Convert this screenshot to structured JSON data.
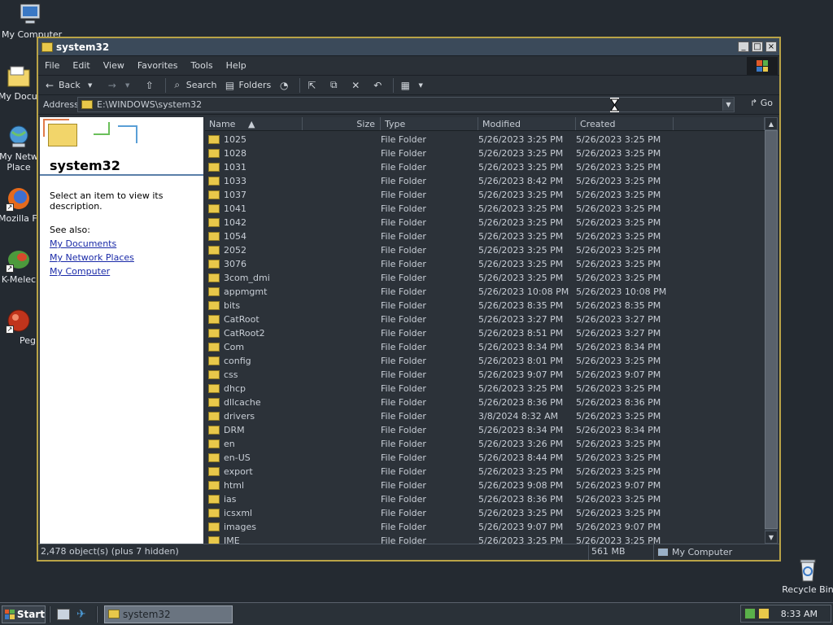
{
  "desktop": {
    "icons": [
      {
        "label": "My Computer"
      },
      {
        "label": "My Documents"
      },
      {
        "label": "My Network Places"
      },
      {
        "label": "Mozilla Firefox"
      },
      {
        "label": "K-Meleon"
      },
      {
        "label": "Pegasus"
      },
      {
        "label": "Recycle Bin"
      }
    ]
  },
  "window": {
    "title": "system32",
    "controls": {
      "minimize": "_",
      "maximize": "□",
      "close": "×"
    },
    "menu": [
      "File",
      "Edit",
      "View",
      "Favorites",
      "Tools",
      "Help"
    ],
    "toolbar": {
      "back": "Back",
      "search": "Search",
      "folders": "Folders"
    },
    "address": {
      "label": "Address",
      "value": "E:\\WINDOWS\\system32",
      "go": "Go"
    },
    "left_pane": {
      "title": "system32",
      "description": "Select an item to view its description.",
      "see_also": "See also:",
      "links": [
        "My Documents",
        "My Network Places",
        "My Computer"
      ]
    },
    "columns": {
      "name": "Name",
      "size": "Size",
      "type": "Type",
      "modified": "Modified",
      "created": "Created"
    },
    "rows": [
      {
        "name": "1025",
        "type": "File Folder",
        "modified": "5/26/2023 3:25 PM",
        "created": "5/26/2023 3:25 PM"
      },
      {
        "name": "1028",
        "type": "File Folder",
        "modified": "5/26/2023 3:25 PM",
        "created": "5/26/2023 3:25 PM"
      },
      {
        "name": "1031",
        "type": "File Folder",
        "modified": "5/26/2023 3:25 PM",
        "created": "5/26/2023 3:25 PM"
      },
      {
        "name": "1033",
        "type": "File Folder",
        "modified": "5/26/2023 8:42 PM",
        "created": "5/26/2023 3:25 PM"
      },
      {
        "name": "1037",
        "type": "File Folder",
        "modified": "5/26/2023 3:25 PM",
        "created": "5/26/2023 3:25 PM"
      },
      {
        "name": "1041",
        "type": "File Folder",
        "modified": "5/26/2023 3:25 PM",
        "created": "5/26/2023 3:25 PM"
      },
      {
        "name": "1042",
        "type": "File Folder",
        "modified": "5/26/2023 3:25 PM",
        "created": "5/26/2023 3:25 PM"
      },
      {
        "name": "1054",
        "type": "File Folder",
        "modified": "5/26/2023 3:25 PM",
        "created": "5/26/2023 3:25 PM"
      },
      {
        "name": "2052",
        "type": "File Folder",
        "modified": "5/26/2023 3:25 PM",
        "created": "5/26/2023 3:25 PM"
      },
      {
        "name": "3076",
        "type": "File Folder",
        "modified": "5/26/2023 3:25 PM",
        "created": "5/26/2023 3:25 PM"
      },
      {
        "name": "3com_dmi",
        "type": "File Folder",
        "modified": "5/26/2023 3:25 PM",
        "created": "5/26/2023 3:25 PM"
      },
      {
        "name": "appmgmt",
        "type": "File Folder",
        "modified": "5/26/2023 10:08 PM",
        "created": "5/26/2023 10:08 PM"
      },
      {
        "name": "bits",
        "type": "File Folder",
        "modified": "5/26/2023 8:35 PM",
        "created": "5/26/2023 8:35 PM"
      },
      {
        "name": "CatRoot",
        "type": "File Folder",
        "modified": "5/26/2023 3:27 PM",
        "created": "5/26/2023 3:27 PM"
      },
      {
        "name": "CatRoot2",
        "type": "File Folder",
        "modified": "5/26/2023 8:51 PM",
        "created": "5/26/2023 3:27 PM"
      },
      {
        "name": "Com",
        "type": "File Folder",
        "modified": "5/26/2023 8:34 PM",
        "created": "5/26/2023 8:34 PM"
      },
      {
        "name": "config",
        "type": "File Folder",
        "modified": "5/26/2023 8:01 PM",
        "created": "5/26/2023 3:25 PM"
      },
      {
        "name": "css",
        "type": "File Folder",
        "modified": "5/26/2023 9:07 PM",
        "created": "5/26/2023 9:07 PM"
      },
      {
        "name": "dhcp",
        "type": "File Folder",
        "modified": "5/26/2023 3:25 PM",
        "created": "5/26/2023 3:25 PM"
      },
      {
        "name": "dllcache",
        "type": "File Folder",
        "modified": "5/26/2023 8:36 PM",
        "created": "5/26/2023 8:36 PM"
      },
      {
        "name": "drivers",
        "type": "File Folder",
        "modified": "3/8/2024 8:32 AM",
        "created": "5/26/2023 3:25 PM"
      },
      {
        "name": "DRM",
        "type": "File Folder",
        "modified": "5/26/2023 8:34 PM",
        "created": "5/26/2023 8:34 PM"
      },
      {
        "name": "en",
        "type": "File Folder",
        "modified": "5/26/2023 3:26 PM",
        "created": "5/26/2023 3:25 PM"
      },
      {
        "name": "en-US",
        "type": "File Folder",
        "modified": "5/26/2023 8:44 PM",
        "created": "5/26/2023 3:25 PM"
      },
      {
        "name": "export",
        "type": "File Folder",
        "modified": "5/26/2023 3:25 PM",
        "created": "5/26/2023 3:25 PM"
      },
      {
        "name": "html",
        "type": "File Folder",
        "modified": "5/26/2023 9:08 PM",
        "created": "5/26/2023 9:07 PM"
      },
      {
        "name": "ias",
        "type": "File Folder",
        "modified": "5/26/2023 8:36 PM",
        "created": "5/26/2023 3:25 PM"
      },
      {
        "name": "icsxml",
        "type": "File Folder",
        "modified": "5/26/2023 3:25 PM",
        "created": "5/26/2023 3:25 PM"
      },
      {
        "name": "images",
        "type": "File Folder",
        "modified": "5/26/2023 9:07 PM",
        "created": "5/26/2023 9:07 PM"
      },
      {
        "name": "IME",
        "type": "File Folder",
        "modified": "5/26/2023 3:25 PM",
        "created": "5/26/2023 3:25 PM"
      }
    ],
    "status": {
      "objects": "2,478 object(s) (plus 7 hidden)",
      "size": "561 MB",
      "location": "My Computer"
    }
  },
  "taskbar": {
    "start": "Start",
    "task": "system32",
    "clock": "8:33 AM"
  },
  "colors": {
    "desktop": "#242a31",
    "window_border": "#b9a347",
    "folder": "#e8c84a",
    "link": "#1a2aa8"
  }
}
